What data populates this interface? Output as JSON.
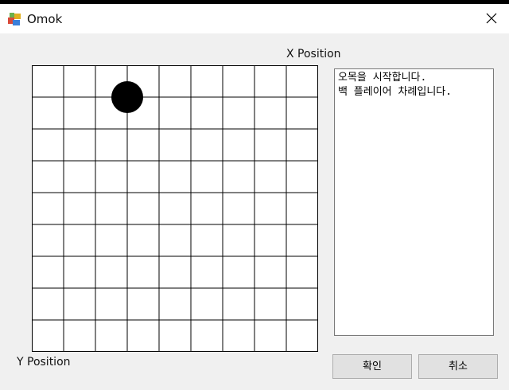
{
  "window": {
    "title": "Omok",
    "close_icon": "close-icon"
  },
  "labels": {
    "x_position": "X Position",
    "y_position": "Y Position"
  },
  "board": {
    "columns": 9,
    "rows": 9,
    "stones": [
      {
        "col": 3,
        "row": 1,
        "color": "#000000"
      }
    ]
  },
  "log": {
    "lines": [
      "오목을 시작합니다.",
      "백 플레이어 차례입니다."
    ]
  },
  "buttons": {
    "ok": "확인",
    "cancel": "취소"
  }
}
